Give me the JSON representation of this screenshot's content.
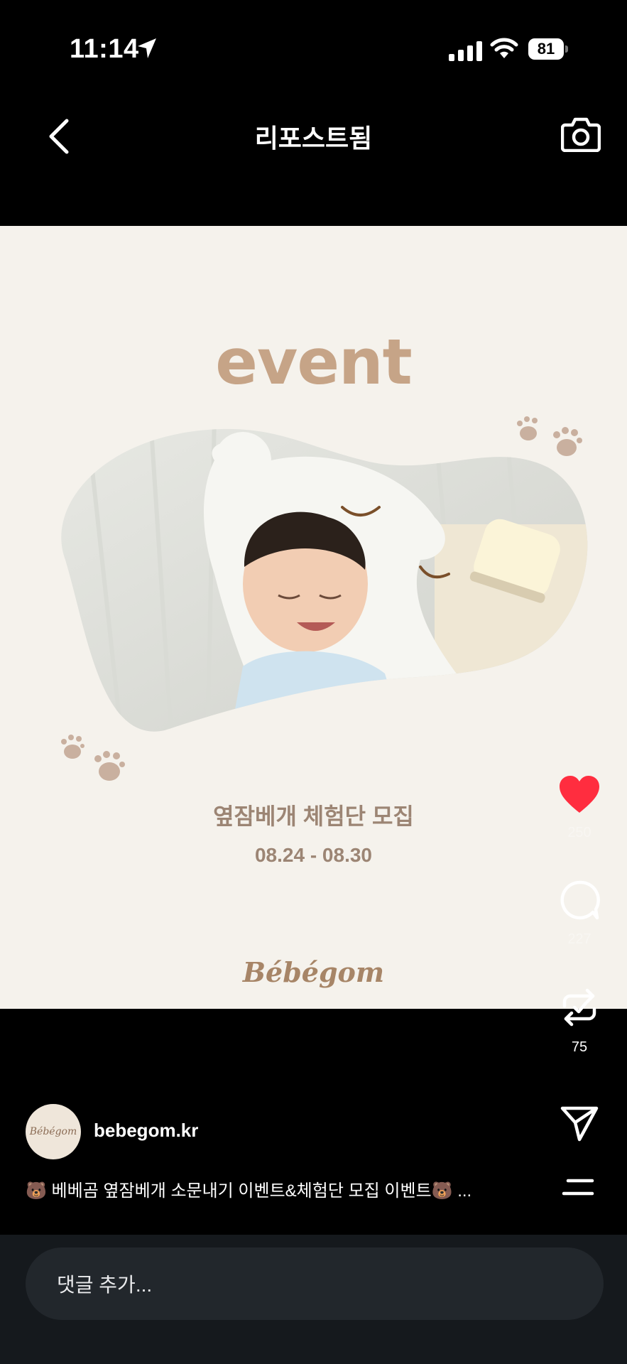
{
  "status_bar": {
    "time": "11:14",
    "battery": "81"
  },
  "header": {
    "title": "리포스트됨"
  },
  "post": {
    "event_word": "event",
    "event_title": "옆잠베개 체험단 모집",
    "event_dates": "08.24 - 08.30",
    "brand": "Bébégom"
  },
  "actions": {
    "likes": "250",
    "comments": "227",
    "reposts": "75"
  },
  "account": {
    "avatar_text": "Bébégom",
    "username": "bebegom.kr",
    "caption": "🐻 베베곰 옆잠베개 소문내기 이벤트&체험단 모집 이벤트🐻 ..."
  },
  "comment_bar": {
    "placeholder": "댓글 추가..."
  },
  "colors": {
    "like": "#ff2d3f",
    "accent": "#c6a487"
  }
}
